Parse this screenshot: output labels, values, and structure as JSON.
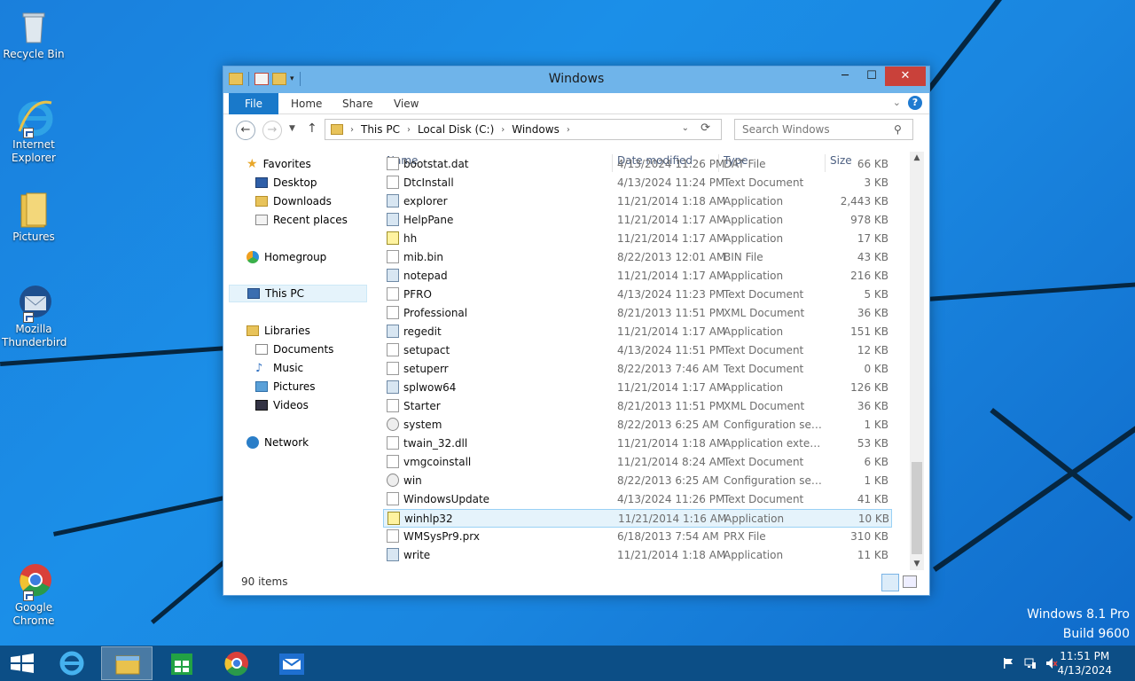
{
  "desktop": {
    "icons": [
      {
        "label": "Recycle Bin"
      },
      {
        "label": "Internet Explorer"
      },
      {
        "label": "Pictures"
      },
      {
        "label": "Mozilla Thunderbird"
      },
      {
        "label": "Google Chrome"
      }
    ],
    "watermark": {
      "line1": "Windows 8.1 Pro",
      "line2": "Build 9600"
    }
  },
  "window": {
    "title": "Windows",
    "ribbon_tabs": [
      "File",
      "Home",
      "Share",
      "View"
    ],
    "address": {
      "parts": [
        "This PC",
        "Local Disk (C:)",
        "Windows"
      ]
    },
    "search_placeholder": "Search Windows",
    "status": "90 items"
  },
  "navpane": {
    "favorites": "Favorites",
    "fav_items": [
      "Desktop",
      "Downloads",
      "Recent places"
    ],
    "homegroup": "Homegroup",
    "thispc": "This PC",
    "libraries": "Libraries",
    "lib_items": [
      "Documents",
      "Music",
      "Pictures",
      "Videos"
    ],
    "network": "Network"
  },
  "columns": {
    "name": "Name",
    "date": "Date modified",
    "type": "Type",
    "size": "Size"
  },
  "files": [
    {
      "name": "bootstat.dat",
      "date": "4/13/2024 11:26 PM",
      "type": "DAT File",
      "size": "66 KB",
      "icon": "doc"
    },
    {
      "name": "DtcInstall",
      "date": "4/13/2024 11:24 PM",
      "type": "Text Document",
      "size": "3 KB",
      "icon": "doc"
    },
    {
      "name": "explorer",
      "date": "11/21/2014 1:18 AM",
      "type": "Application",
      "size": "2,443 KB",
      "icon": "app"
    },
    {
      "name": "HelpPane",
      "date": "11/21/2014 1:17 AM",
      "type": "Application",
      "size": "978 KB",
      "icon": "app"
    },
    {
      "name": "hh",
      "date": "11/21/2014 1:17 AM",
      "type": "Application",
      "size": "17 KB",
      "icon": "help"
    },
    {
      "name": "mib.bin",
      "date": "8/22/2013 12:01 AM",
      "type": "BIN File",
      "size": "43 KB",
      "icon": "doc"
    },
    {
      "name": "notepad",
      "date": "11/21/2014 1:17 AM",
      "type": "Application",
      "size": "216 KB",
      "icon": "app"
    },
    {
      "name": "PFRO",
      "date": "4/13/2024 11:23 PM",
      "type": "Text Document",
      "size": "5 KB",
      "icon": "doc"
    },
    {
      "name": "Professional",
      "date": "8/21/2013 11:51 PM",
      "type": "XML Document",
      "size": "36 KB",
      "icon": "doc"
    },
    {
      "name": "regedit",
      "date": "11/21/2014 1:17 AM",
      "type": "Application",
      "size": "151 KB",
      "icon": "app"
    },
    {
      "name": "setupact",
      "date": "4/13/2024 11:51 PM",
      "type": "Text Document",
      "size": "12 KB",
      "icon": "doc"
    },
    {
      "name": "setuperr",
      "date": "8/22/2013 7:46 AM",
      "type": "Text Document",
      "size": "0 KB",
      "icon": "doc"
    },
    {
      "name": "splwow64",
      "date": "11/21/2014 1:17 AM",
      "type": "Application",
      "size": "126 KB",
      "icon": "app"
    },
    {
      "name": "Starter",
      "date": "8/21/2013 11:51 PM",
      "type": "XML Document",
      "size": "36 KB",
      "icon": "doc"
    },
    {
      "name": "system",
      "date": "8/22/2013 6:25 AM",
      "type": "Configuration sett...",
      "size": "1 KB",
      "icon": "cfg"
    },
    {
      "name": "twain_32.dll",
      "date": "11/21/2014 1:18 AM",
      "type": "Application extens...",
      "size": "53 KB",
      "icon": "doc"
    },
    {
      "name": "vmgcoinstall",
      "date": "11/21/2014 8:24 AM",
      "type": "Text Document",
      "size": "6 KB",
      "icon": "doc"
    },
    {
      "name": "win",
      "date": "8/22/2013 6:25 AM",
      "type": "Configuration sett...",
      "size": "1 KB",
      "icon": "cfg"
    },
    {
      "name": "WindowsUpdate",
      "date": "4/13/2024 11:26 PM",
      "type": "Text Document",
      "size": "41 KB",
      "icon": "doc"
    },
    {
      "name": "winhlp32",
      "date": "11/21/2014 1:16 AM",
      "type": "Application",
      "size": "10 KB",
      "icon": "help",
      "selected": true
    },
    {
      "name": "WMSysPr9.prx",
      "date": "6/18/2013 7:54 AM",
      "type": "PRX File",
      "size": "310 KB",
      "icon": "doc"
    },
    {
      "name": "write",
      "date": "11/21/2014 1:18 AM",
      "type": "Application",
      "size": "11 KB",
      "icon": "app"
    }
  ],
  "taskbar": {
    "time": "11:51 PM",
    "date": "4/13/2024"
  }
}
